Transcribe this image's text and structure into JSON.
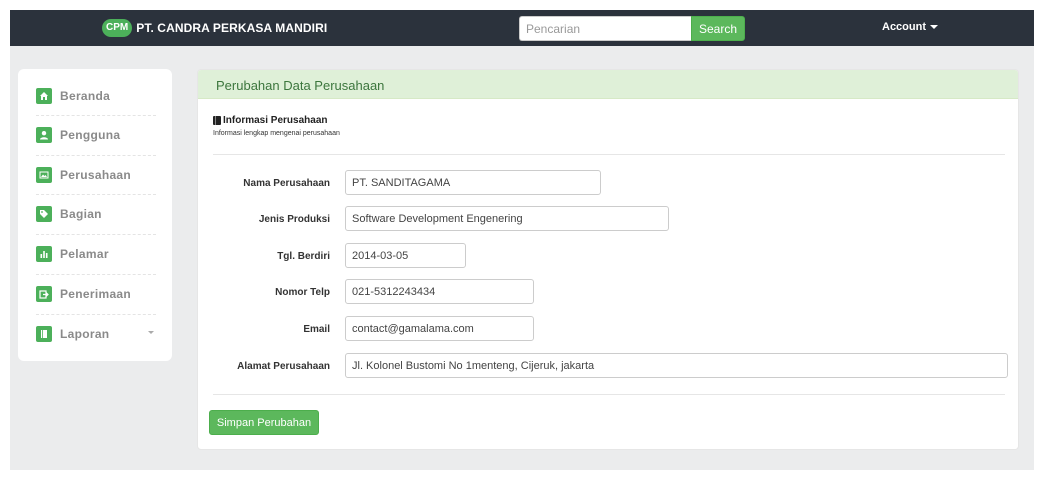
{
  "navbar": {
    "brand_badge": "CPM",
    "brand_name": "PT. CANDRA PERKASA MANDIRI",
    "search_placeholder": "Pencarian",
    "search_button": "Search",
    "account_label": "Account"
  },
  "sidebar": {
    "items": [
      {
        "label": "Beranda",
        "icon": "home-icon"
      },
      {
        "label": "Pengguna",
        "icon": "user-icon"
      },
      {
        "label": "Perusahaan",
        "icon": "picture-icon"
      },
      {
        "label": "Bagian",
        "icon": "tags-icon"
      },
      {
        "label": "Pelamar",
        "icon": "stats-icon"
      },
      {
        "label": "Penerimaan",
        "icon": "share-icon"
      },
      {
        "label": "Laporan",
        "icon": "book-icon"
      }
    ]
  },
  "panel": {
    "title": "Perubahan Data Perusahaan",
    "section_title": "Informasi Perusahaan",
    "section_subtitle": "Informasi lengkap mengenai perusahaan",
    "fields": {
      "nama": {
        "label": "Nama Perusahaan",
        "value": "PT. SANDITAGAMA"
      },
      "jenis": {
        "label": "Jenis Produksi",
        "value": "Software Development Engenering"
      },
      "tgl": {
        "label": "Tgl. Berdiri",
        "value": "2014-03-05"
      },
      "telp": {
        "label": "Nomor Telp",
        "value": "021-5312243434"
      },
      "email": {
        "label": "Email",
        "value": "contact@gamalama.com"
      },
      "alamat": {
        "label": "Alamat Perusahaan",
        "value": "Jl. Kolonel Bustomi No 1menteng, Cijeruk, jakarta"
      }
    },
    "save_button": "Simpan Perubahan"
  },
  "colors": {
    "navbar_bg": "#2b323c",
    "accent_green": "#5cb85c",
    "panel_heading_bg": "#dff0d8",
    "panel_heading_text": "#3c763d",
    "page_bg": "#ebeced"
  }
}
